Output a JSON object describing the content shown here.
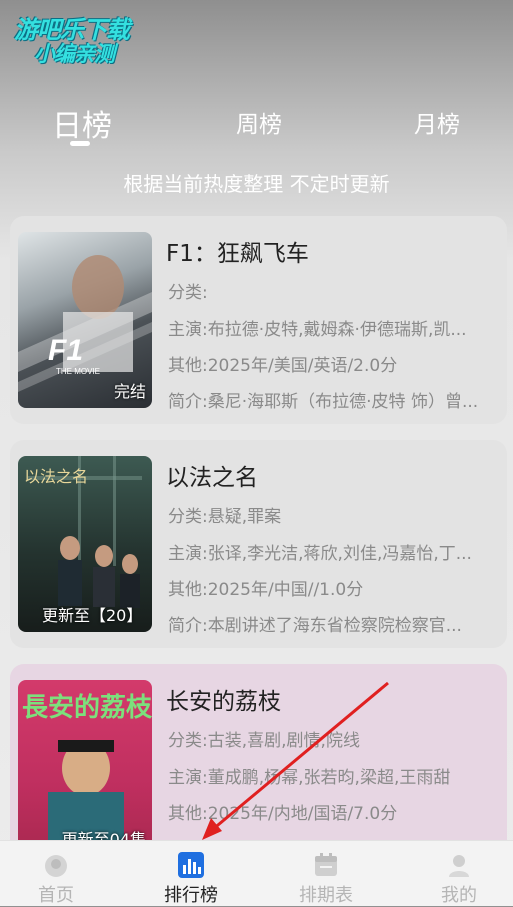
{
  "watermark": {
    "line1": "游吧乐下载",
    "line2": "小编亲测"
  },
  "tabs": {
    "day": "日榜",
    "week": "周榜",
    "month": "月榜"
  },
  "subtitle": "根据当前热度整理 不定时更新",
  "labels": {
    "category": "分类:",
    "cast": "主演:",
    "other": "其他:",
    "intro": "简介:"
  },
  "items": [
    {
      "title": "F1：狂飙飞车",
      "category": "",
      "cast": "布拉德·皮特,戴姆森·伊德瑞斯,凯...",
      "other": "2025年/美国/英语/2.0分",
      "intro": "桑尼·海耶斯（布拉德·皮特 饰）曾...",
      "badge": "完结"
    },
    {
      "title": "以法之名",
      "category": "悬疑,罪案",
      "cast": "张译,李光洁,蒋欣,刘佳,冯嘉怡,丁...",
      "other": "2025年/中国//1.0分",
      "intro": "本剧讲述了海东省检察院检察官...",
      "badge": "更新至【20】"
    },
    {
      "title": "长安的荔枝",
      "category": "古装,喜剧,剧情,院线",
      "cast": "董成鹏,杨幂,张若昀,梁超,王雨甜",
      "other": "2025年/内地/国语/7.0分",
      "intro": "",
      "badge": "更新至04集"
    }
  ],
  "nav": {
    "home": "首页",
    "rank": "排行榜",
    "schedule": "排期表",
    "mine": "我的"
  },
  "colors": {
    "annotation_arrow": "#e02020",
    "watermark": "#34e0e0"
  }
}
